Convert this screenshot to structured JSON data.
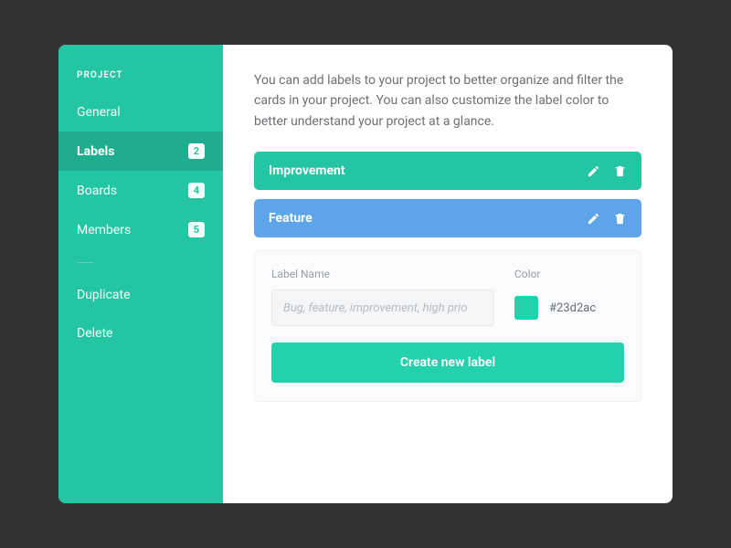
{
  "sidebar": {
    "heading": "PROJECT",
    "items": [
      {
        "label": "General",
        "count": ""
      },
      {
        "label": "Labels",
        "count": "2"
      },
      {
        "label": "Boards",
        "count": "4"
      },
      {
        "label": "Members",
        "count": "5"
      }
    ],
    "extra": [
      {
        "label": "Duplicate"
      },
      {
        "label": "Delete"
      }
    ]
  },
  "main": {
    "description": "You can add labels to your project to better organize and filter the cards in your project. You can also customize the label color to better understand your project at a glance.",
    "labels": [
      {
        "name": "Improvement",
        "color": "#23c5a3"
      },
      {
        "name": "Feature",
        "color": "#5da5e8"
      }
    ],
    "form": {
      "name_label": "Label Name",
      "name_placeholder": "Bug, feature, improvement, high prio",
      "color_label": "Color",
      "color_value": "#23d2ac",
      "submit_label": "Create new label"
    }
  }
}
